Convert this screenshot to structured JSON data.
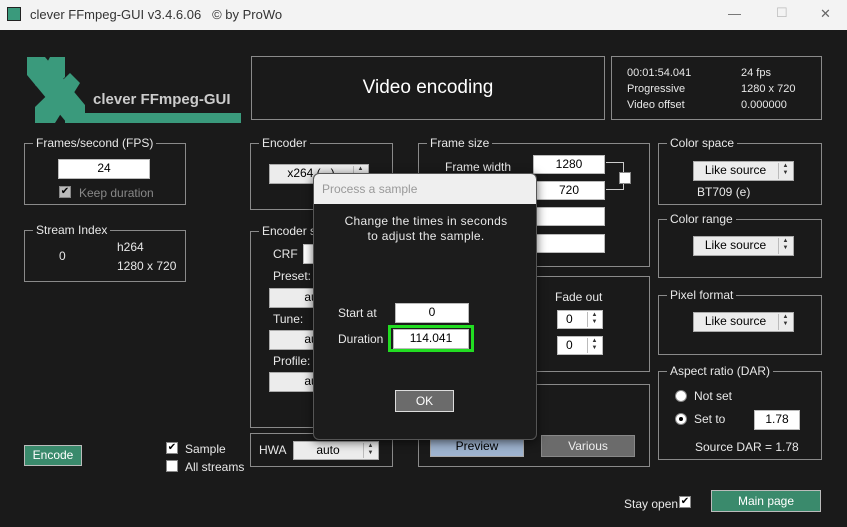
{
  "window": {
    "title": "clever FFmpeg-GUI v3.4.6.06   © by ProWo",
    "minimize": "—",
    "maximize": "☐",
    "close": "✕"
  },
  "logo": {
    "text": "clever FFmpeg-GUI",
    "color": "#3a9a7c"
  },
  "header": {
    "title": "Video encoding"
  },
  "info": {
    "duration": "00:01:54.041",
    "fps": "24 fps",
    "scan": "Progressive",
    "resolution": "1280 x 720",
    "offset_label": "Video offset",
    "offset": "0.000000"
  },
  "fps_group": {
    "label": "Frames/second (FPS)",
    "value": "24",
    "keep_duration": "Keep duration",
    "keep_checked": true
  },
  "stream_group": {
    "label": "Stream Index",
    "index": "0",
    "codec": "h264",
    "resolution": "1280 x 720"
  },
  "encoder_group": {
    "label": "Encoder",
    "value": "x264 (...)"
  },
  "encoder_settings": {
    "label": "Encoder se",
    "crf": "CRF",
    "preset": "Preset:",
    "tune": "Tune:",
    "profile": "Profile:",
    "preset_value": "au",
    "tune_value": "au",
    "profile_value": "au"
  },
  "hwa": {
    "label": "HWA",
    "value": "auto"
  },
  "frame_size": {
    "label": "Frame size",
    "width_label": "Frame width",
    "width": "1280",
    "height": "720"
  },
  "fade": {
    "label": "Fade out",
    "v1": "0",
    "v2": "0"
  },
  "buttons": {
    "preview": "Preview",
    "various": "Various",
    "encode": "Encode",
    "main_page": "Main page",
    "ok": "OK"
  },
  "color_space": {
    "label": "Color space",
    "value": "Like source",
    "info": "BT709 (e)"
  },
  "color_range": {
    "label": "Color range",
    "value": "Like source"
  },
  "pixel_format": {
    "label": "Pixel format",
    "value": "Like source"
  },
  "aspect": {
    "label": "Aspect ratio (DAR)",
    "not_set": "Not set",
    "set_to": "Set to",
    "value": "1.78",
    "source": "Source DAR = 1.78",
    "selected": "set_to"
  },
  "sample": {
    "label": "Sample",
    "checked": true
  },
  "all_streams": {
    "label": "All streams",
    "checked": false
  },
  "stay_open": {
    "label": "Stay open",
    "checked": true
  },
  "dialog": {
    "title": "Process a sample",
    "line1": "Change the times in seconds",
    "line2": "to adjust the sample.",
    "start_label": "Start at",
    "start": "0",
    "duration_label": "Duration",
    "duration": "114.041",
    "highlight": "#22dd22"
  }
}
